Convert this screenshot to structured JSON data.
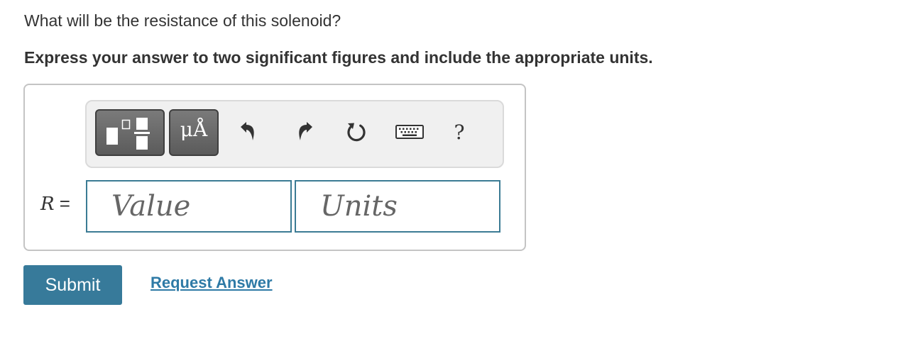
{
  "question": {
    "text": "What will be the resistance of this solenoid?",
    "instruction": "Express your answer to two significant figures and include the appropriate units."
  },
  "toolbar": {
    "buttons": [
      {
        "name": "templates-icon"
      },
      {
        "name": "units-icon",
        "glyph": "μÅ"
      },
      {
        "name": "undo-icon"
      },
      {
        "name": "redo-icon"
      },
      {
        "name": "reset-icon"
      },
      {
        "name": "keyboard-icon"
      },
      {
        "name": "help-icon",
        "glyph": "?"
      }
    ]
  },
  "answer": {
    "variable": "R",
    "equals": " =",
    "value_placeholder": "Value",
    "value": "",
    "units_placeholder": "Units",
    "units": ""
  },
  "actions": {
    "submit_label": "Submit",
    "request_label": "Request Answer"
  },
  "colors": {
    "accent": "#377a9a",
    "link": "#2e7aa6",
    "field_border": "#3b7b94"
  }
}
